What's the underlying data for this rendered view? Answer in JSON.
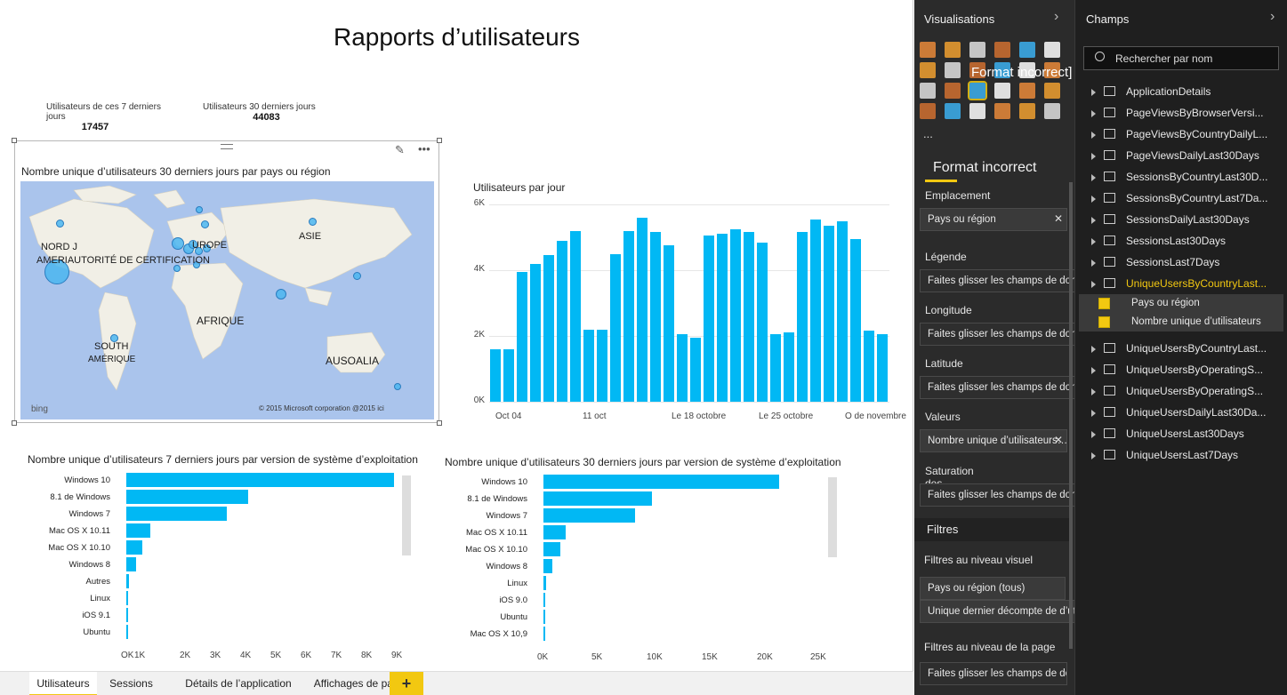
{
  "report": {
    "title": "Rapports d’utilisateurs"
  },
  "cards": [
    {
      "label": "Utilisateurs de ces 7 derniers jours",
      "value": "17457"
    },
    {
      "label": "Utilisateurs 30 derniers jours",
      "value": "44083"
    }
  ],
  "map": {
    "title": "Nombre unique d’utilisateurs 30 derniers jours par pays ou région",
    "labels": [
      "NORD J",
      "AMERIAUTORITÉ DE CERTIFICATION",
      "UROPE",
      "ASIE",
      "AFRIQUE",
      "SOUTH",
      "AMÉRIQUE",
      "AUSOALIA"
    ],
    "attribution": "© 2015 Microsoft corporation @2015 ici",
    "bing": "bing"
  },
  "chart_data": [
    {
      "type": "bar",
      "title": "Utilisateurs par jour",
      "ytick_labels": [
        "0K",
        "2K",
        "4K",
        "6K"
      ],
      "xtick_labels": [
        "Oct 04",
        "11 oct",
        "Le 18 octobre",
        "Le 25 octobre",
        "O de novembre"
      ],
      "ylim": [
        0,
        6000
      ],
      "values": [
        1600,
        1600,
        3950,
        4200,
        4450,
        4900,
        5200,
        2200,
        2200,
        4500,
        5200,
        5600,
        5150,
        4750,
        2050,
        1950,
        5050,
        5100,
        5250,
        5150,
        4850,
        2050,
        2100,
        5150,
        5550,
        5350,
        5500,
        4950,
        2150,
        2050
      ]
    },
    {
      "type": "bar",
      "orientation": "horizontal",
      "title": "Nombre unique d’utilisateurs 7 derniers jours par version de système d’exploitation",
      "categories": [
        "Windows 10",
        "8.1 de Windows",
        "Windows 7",
        "Mac OS X 10.11",
        "Mac OS X 10.10",
        "Windows 8",
        "Autres",
        "Linux",
        "iOS 9.1",
        "Ubuntu"
      ],
      "values": [
        8900,
        4050,
        3350,
        800,
        520,
        330,
        80,
        60,
        40,
        30
      ],
      "xtick_labels": [
        "OK",
        "1K",
        "2K",
        "3K",
        "4K",
        "5K",
        "6K",
        "7K",
        "8K",
        "9K"
      ],
      "xlim": [
        0,
        9000
      ]
    },
    {
      "type": "bar",
      "orientation": "horizontal",
      "title": "Nombre unique d’utilisateurs 30 derniers jours par version de système d’exploitation",
      "categories": [
        "Windows 10",
        "8.1 de Windows",
        "Windows 7",
        "Mac OS X 10.11",
        "Mac OS X 10.10",
        "Windows 8",
        "Linux",
        "iOS 9.0",
        "Ubuntu",
        "Mac OS X 10,9"
      ],
      "values": [
        23400,
        10800,
        9100,
        2200,
        1700,
        850,
        250,
        150,
        120,
        80
      ],
      "xtick_labels": [
        "0K",
        "5K",
        "10K",
        "15K",
        "20K",
        "25K"
      ],
      "xlim": [
        0,
        27000
      ]
    }
  ],
  "tabs": [
    {
      "label": "Utilisateurs",
      "active": true
    },
    {
      "label": "Sessions",
      "active": false
    },
    {
      "label": "Détails de l’application",
      "active": false
    },
    {
      "label": "Affichages de page",
      "active": false
    }
  ],
  "tab_add": "+",
  "viz_pane": {
    "title": "Visualisations",
    "tooltip": "Format incorrect]",
    "more": "...",
    "format_tab": "Format incorrect",
    "sections": [
      {
        "label": "Emplacement",
        "value": "Pays ou région",
        "filled": true
      },
      {
        "label": "Légende",
        "value": "Faites glisser les champs de données ici",
        "filled": false
      },
      {
        "label": "Longitude",
        "value": "Faites glisser les champs de données ici",
        "filled": false
      },
      {
        "label": "Latitude",
        "value": "Faites glisser les champs de données ici",
        "filled": false
      },
      {
        "label": "Valeurs",
        "value": "Nombre unique d’utilisateurs…",
        "filled": true
      },
      {
        "label": "Saturation des couleurs",
        "value": "Faites glisser les champs de données ici",
        "filled": false
      }
    ],
    "filters": {
      "header": "Filtres",
      "visual_level": "Filtres au niveau visuel",
      "visual_items": [
        "Pays ou région (tous)",
        "Unique dernier décompte de d’utilisateurs..."
      ],
      "page_level": "Filtres au niveau de la page",
      "page_placeholder": "Faites glisser les champs de données ici"
    }
  },
  "fields_pane": {
    "title": "Champs",
    "search_placeholder": "Rechercher par nom",
    "tables": [
      "ApplicationDetails",
      "PageViewsByBrowserVersi...",
      "PageViewsByCountryDailyL...",
      "PageViewsDailyLast30Days",
      "SessionsByCountryLast30D...",
      "SessionsByCountryLast7Da...",
      "SessionsDailyLast30Days",
      "SessionsLast30Days",
      "SessionsLast7Days",
      "UniqueUsersByCountryLast...",
      "UniqueUsersByCountryLast...",
      "UniqueUsersByOperatingS...",
      "UniqueUsersByOperatingS...",
      "UniqueUsersDailyLast30Da...",
      "UniqueUsersLast30Days",
      "UniqueUsersLast7Days"
    ],
    "expanded_fields": [
      "Pays ou région",
      "Nombre unique d’utilisateurs"
    ],
    "highlight_color": "#f2c811"
  },
  "colors": {
    "bar": "#01b8f4",
    "accent": "#f2c811",
    "pane_dark": "#2b2b2b"
  }
}
